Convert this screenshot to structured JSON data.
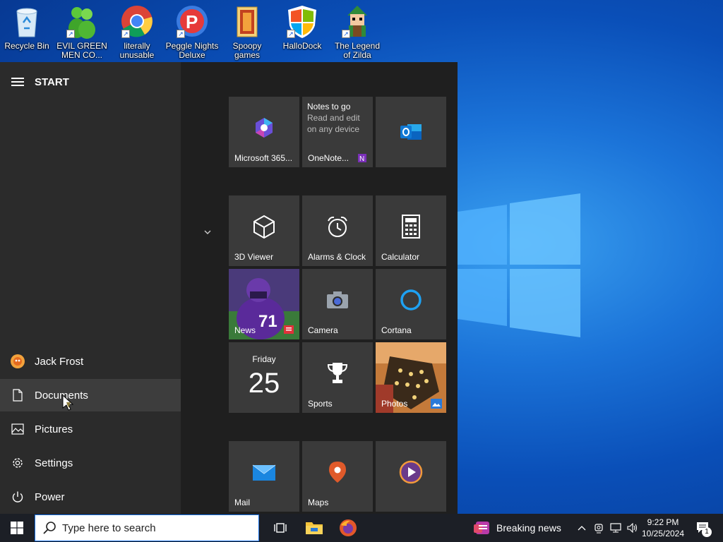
{
  "desktop": {
    "icons": [
      {
        "label": "Recycle Bin",
        "icon": "recycle-bin-icon",
        "shortcut": false
      },
      {
        "label": "EVIL GREEN MEN CO...",
        "icon": "green-men-icon",
        "shortcut": true
      },
      {
        "label": "literally unusable",
        "icon": "chrome-icon",
        "shortcut": true
      },
      {
        "label": "Peggle Nights Deluxe",
        "icon": "peggle-icon",
        "shortcut": true
      },
      {
        "label": "Spoopy games",
        "icon": "folder-games-icon",
        "shortcut": false
      },
      {
        "label": "HalloDock",
        "icon": "windows-shield-icon",
        "shortcut": true
      },
      {
        "label": "The Legend of Zilda",
        "icon": "zelda-icon",
        "shortcut": true
      }
    ]
  },
  "start_menu": {
    "title": "START",
    "user": "Jack Frost",
    "left_items": [
      {
        "label": "Documents",
        "icon": "document-icon"
      },
      {
        "label": "Pictures",
        "icon": "pictures-icon"
      },
      {
        "label": "Settings",
        "icon": "gear-icon"
      },
      {
        "label": "Power",
        "icon": "power-icon"
      }
    ],
    "tiles": {
      "microsoft365": "Microsoft 365...",
      "onenote": {
        "label": "OneNote...",
        "title": "Notes to go",
        "subtitle": "Read and edit on any device"
      },
      "outlook": "",
      "viewer3d": "3D Viewer",
      "alarms": "Alarms & Clock",
      "calculator": "Calculator",
      "news": "News",
      "camera": "Camera",
      "cortana": "Cortana",
      "calendar": {
        "day": "Friday",
        "date": "25"
      },
      "sports": "Sports",
      "photos": "Photos",
      "mail": "Mail",
      "maps": "Maps",
      "media": ""
    }
  },
  "taskbar": {
    "search_placeholder": "Type here to search",
    "news_label": "Breaking news",
    "time": "9:22 PM",
    "date": "10/25/2024",
    "notification_count": "1"
  },
  "colors": {
    "accent": "#1a73e8",
    "tile_bg": "#3a3a3a",
    "menu_bg": "#2b2b2b",
    "taskbar": "#1c1f26"
  }
}
